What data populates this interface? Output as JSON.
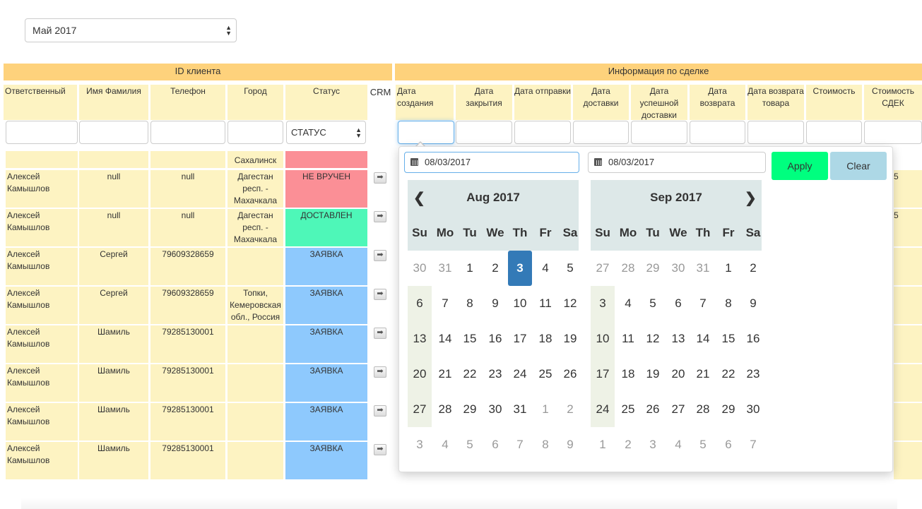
{
  "month_select": {
    "value": "Май 2017"
  },
  "groups": {
    "client": "ID клиента",
    "deal": "Информация по сделке"
  },
  "columns": {
    "responsible": "Ответственный",
    "name": "Имя Фамилия",
    "phone": "Телефон",
    "city": "Город",
    "status": "Статус",
    "crm": "CRM",
    "created": "Дата создания",
    "closed": "Дата закрытия",
    "sent": "Дата отправки",
    "delivered": "Дата доставки",
    "success_delivery": "Дата успешной доставки",
    "returned": "Дата возврата",
    "goods_return": "Дата возврата товара",
    "cost": "Стоимость",
    "cdek_cost": "Стоимость СДЕК"
  },
  "status_filter": {
    "value": "СТАТУС"
  },
  "partial_row": {
    "city": "Сахалинск"
  },
  "rows": [
    {
      "responsible": "Алексей Камышлов",
      "name": "null",
      "phone": "null",
      "city": "Дагестан респ. - Махачкала",
      "status": "НЕ ВРУЧЕН",
      "status_color": "#fb8f96",
      "right_text": "5"
    },
    {
      "responsible": "Алексей Камышлов",
      "name": "null",
      "phone": "null",
      "city": "Дагестан респ. - Махачкала",
      "status": "ДОСТАВЛЕН",
      "status_color": "#4ef7b8",
      "right_text": "5"
    },
    {
      "responsible": "Алексей Камышлов",
      "name": "Сергей",
      "phone": "79609328659",
      "city": "",
      "status": "ЗАЯВКА",
      "status_color": "#8ec9fd",
      "right_text": ""
    },
    {
      "responsible": "Алексей Камышлов",
      "name": "Сергей",
      "phone": "79609328659",
      "city": "Топки, Кемеровская обл., Россия",
      "status": "ЗАЯВКА",
      "status_color": "#8ec9fd",
      "right_text": ""
    },
    {
      "responsible": "Алексей Камышлов",
      "name": "Шамиль",
      "phone": "79285130001",
      "city": "",
      "status": "ЗАЯВКА",
      "status_color": "#8ec9fd",
      "right_text": ""
    },
    {
      "responsible": "Алексей Камышлов",
      "name": "Шамиль",
      "phone": "79285130001",
      "city": "",
      "status": "ЗАЯВКА",
      "status_color": "#8ec9fd",
      "right_text": ""
    },
    {
      "responsible": "Алексей Камышлов",
      "name": "Шамиль",
      "phone": "79285130001",
      "city": "",
      "status": "ЗАЯВКА",
      "status_color": "#8ec9fd",
      "right_text": ""
    },
    {
      "responsible": "Алексей Камышлов",
      "name": "Шамиль",
      "phone": "79285130001",
      "city": "",
      "status": "ЗАЯВКА",
      "status_color": "#8ec9fd",
      "right_text": ""
    }
  ],
  "crm_icon": "arrow-right-icon",
  "datepicker": {
    "start_date": "08/03/2017",
    "end_date": "08/03/2017",
    "apply_label": "Apply",
    "clear_label": "Clear",
    "prev_icon": "chevron-left-icon",
    "next_icon": "chevron-right-icon",
    "weekdays": [
      "Su",
      "Mo",
      "Tu",
      "We",
      "Th",
      "Fr",
      "Sa"
    ],
    "calendars": [
      {
        "title": "Aug 2017",
        "weeks": [
          [
            {
              "d": "30",
              "m": true
            },
            {
              "d": "31",
              "m": true
            },
            {
              "d": "1"
            },
            {
              "d": "2"
            },
            {
              "d": "3",
              "sel": true
            },
            {
              "d": "4"
            },
            {
              "d": "5"
            }
          ],
          [
            {
              "d": "6"
            },
            {
              "d": "7"
            },
            {
              "d": "8"
            },
            {
              "d": "9"
            },
            {
              "d": "10"
            },
            {
              "d": "11"
            },
            {
              "d": "12"
            }
          ],
          [
            {
              "d": "13"
            },
            {
              "d": "14"
            },
            {
              "d": "15"
            },
            {
              "d": "16"
            },
            {
              "d": "17"
            },
            {
              "d": "18"
            },
            {
              "d": "19"
            }
          ],
          [
            {
              "d": "20"
            },
            {
              "d": "21"
            },
            {
              "d": "22"
            },
            {
              "d": "23"
            },
            {
              "d": "24"
            },
            {
              "d": "25"
            },
            {
              "d": "26"
            }
          ],
          [
            {
              "d": "27"
            },
            {
              "d": "28"
            },
            {
              "d": "29"
            },
            {
              "d": "30"
            },
            {
              "d": "31"
            },
            {
              "d": "1",
              "m": true
            },
            {
              "d": "2",
              "m": true
            }
          ],
          [
            {
              "d": "3",
              "m": true
            },
            {
              "d": "4",
              "m": true
            },
            {
              "d": "5",
              "m": true
            },
            {
              "d": "6",
              "m": true
            },
            {
              "d": "7",
              "m": true
            },
            {
              "d": "8",
              "m": true
            },
            {
              "d": "9",
              "m": true
            }
          ]
        ]
      },
      {
        "title": "Sep 2017",
        "weeks": [
          [
            {
              "d": "27",
              "m": true
            },
            {
              "d": "28",
              "m": true
            },
            {
              "d": "29",
              "m": true
            },
            {
              "d": "30",
              "m": true
            },
            {
              "d": "31",
              "m": true
            },
            {
              "d": "1"
            },
            {
              "d": "2"
            }
          ],
          [
            {
              "d": "3"
            },
            {
              "d": "4"
            },
            {
              "d": "5"
            },
            {
              "d": "6"
            },
            {
              "d": "7"
            },
            {
              "d": "8"
            },
            {
              "d": "9"
            }
          ],
          [
            {
              "d": "10"
            },
            {
              "d": "11"
            },
            {
              "d": "12"
            },
            {
              "d": "13"
            },
            {
              "d": "14"
            },
            {
              "d": "15"
            },
            {
              "d": "16"
            }
          ],
          [
            {
              "d": "17"
            },
            {
              "d": "18"
            },
            {
              "d": "19"
            },
            {
              "d": "20"
            },
            {
              "d": "21"
            },
            {
              "d": "22"
            },
            {
              "d": "23"
            }
          ],
          [
            {
              "d": "24"
            },
            {
              "d": "25"
            },
            {
              "d": "26"
            },
            {
              "d": "27"
            },
            {
              "d": "28"
            },
            {
              "d": "29"
            },
            {
              "d": "30"
            }
          ],
          [
            {
              "d": "1",
              "m": true
            },
            {
              "d": "2",
              "m": true
            },
            {
              "d": "3",
              "m": true
            },
            {
              "d": "4",
              "m": true
            },
            {
              "d": "5",
              "m": true
            },
            {
              "d": "6",
              "m": true
            },
            {
              "d": "7",
              "m": true
            }
          ]
        ]
      }
    ]
  }
}
